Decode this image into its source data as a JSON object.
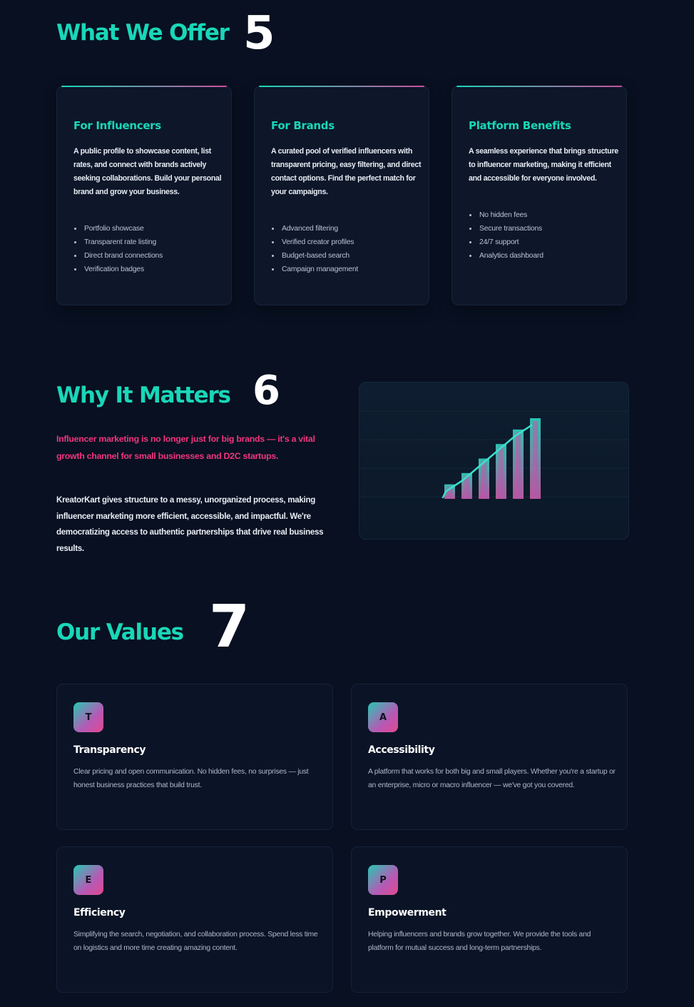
{
  "offer": {
    "title": "What We Offer",
    "marker": "5",
    "cards": [
      {
        "title": "For Influencers",
        "description": "A public profile to showcase content, list rates, and connect with brands actively seeking collaborations. Build your personal brand and grow your business.",
        "features": [
          "Portfolio showcase",
          "Transparent rate listing",
          "Direct brand connections",
          "Verification badges"
        ]
      },
      {
        "title": "For Brands",
        "description": "A curated pool of verified influencers with transparent pricing, easy filtering, and direct contact options. Find the perfect match for your campaigns.",
        "features": [
          "Advanced filtering",
          "Verified creator profiles",
          "Budget-based search",
          "Campaign management"
        ]
      },
      {
        "title": "Platform Benefits",
        "description": "A seamless experience that brings structure to influencer marketing, making it efficient and accessible for everyone involved.",
        "features": [
          "No hidden fees",
          "Secure transactions",
          "24/7 support",
          "Analytics dashboard"
        ]
      }
    ]
  },
  "why": {
    "title": "Why It Matters",
    "marker": "6",
    "highlight": "Influencer marketing is no longer just for big brands — it's a vital growth channel for small businesses and D2C startups.",
    "body": "KreatorKart gives structure to a messy, unorganized process, making influencer marketing more efficient, accessible, and impactful. We're democratizing access to authentic partnerships that drive real business results.",
    "illustration_icon": "growth-bar-chart-icon",
    "bar_levels": [
      0.18,
      0.32,
      0.5,
      0.68,
      0.86,
      1.0
    ]
  },
  "values": {
    "title": "Our Values",
    "marker": "7",
    "items": [
      {
        "letter": "T",
        "title": "Transparency",
        "description": "Clear pricing and open communication. No hidden fees, no surprises — just honest business practices that build trust."
      },
      {
        "letter": "A",
        "title": "Accessibility",
        "description": "A platform that works for both big and small players. Whether you're a startup or an enterprise, micro or macro influencer — we've got you covered."
      },
      {
        "letter": "E",
        "title": "Efficiency",
        "description": "Simplifying the search, negotiation, and collaboration process. Spend less time on logistics and more time creating amazing content."
      },
      {
        "letter": "P",
        "title": "Empowerment",
        "description": "Helping influencers and brands grow together. We provide the tools and platform for mutual success and long-term partnerships."
      }
    ]
  },
  "colors": {
    "background": "#081021",
    "accent_teal": "#19d7b8",
    "accent_pink": "#f0357f",
    "card": "#0d1729"
  }
}
